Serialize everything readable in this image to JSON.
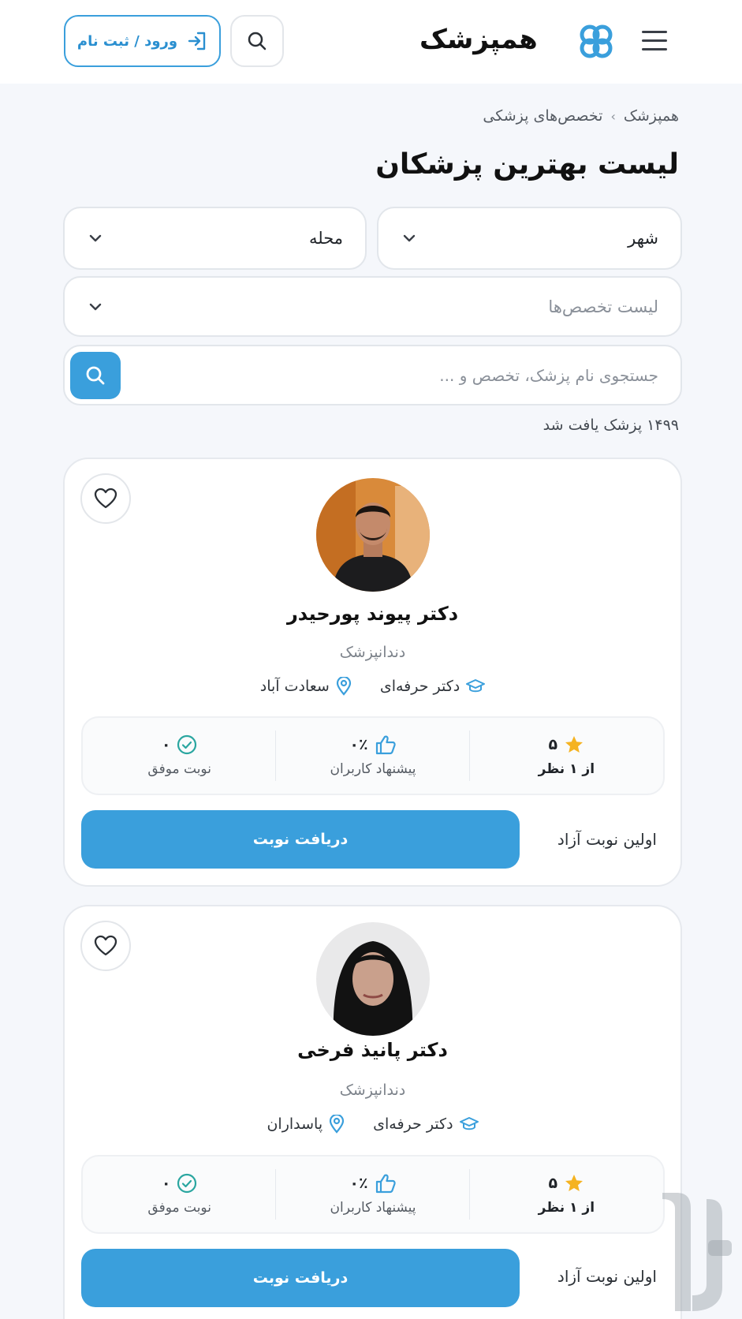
{
  "header": {
    "logo_text": "همپزشک",
    "login_label": "ورود / ثبت نام"
  },
  "breadcrumb": {
    "home": "همپزشک",
    "current": "تخصص‌های پزشکی"
  },
  "page_title": "لیست بهترین پزشکان",
  "filters": {
    "city": "شهر",
    "neighborhood": "محله",
    "specialties": "لیست تخصص‌ها"
  },
  "search": {
    "placeholder": "جستجوی نام پزشک، تخصص و ..."
  },
  "result_count": "۱۴۹۹ پزشک یافت شد",
  "colors": {
    "accent": "#3a9fdc",
    "star": "#f5b321"
  },
  "doctors": [
    {
      "name": "دکتر پیوند پورحیدر",
      "specialty": "دندانپزشک",
      "badge": "دکتر حرفه‌ای",
      "location": "سعادت آباد",
      "rating": "۵",
      "reviews": "از ۱ نظر",
      "recommend": "۰٪",
      "recommend_label": "پیشنهاد کاربران",
      "appointments": "۰",
      "appointments_label": "نوبت موفق",
      "first_free": "اولین نوبت آزاد",
      "book_label": "دریافت نوبت"
    },
    {
      "name": "دکتر پانیذ فرخی",
      "specialty": "دندانپزشک",
      "badge": "دکتر حرفه‌ای",
      "location": "پاسداران",
      "rating": "۵",
      "reviews": "از ۱ نظر",
      "recommend": "۰٪",
      "recommend_label": "پیشنهاد کاربران",
      "appointments": "۰",
      "appointments_label": "نوبت موفق",
      "first_free": "اولین نوبت آزاد",
      "book_label": "دریافت نوبت"
    }
  ]
}
